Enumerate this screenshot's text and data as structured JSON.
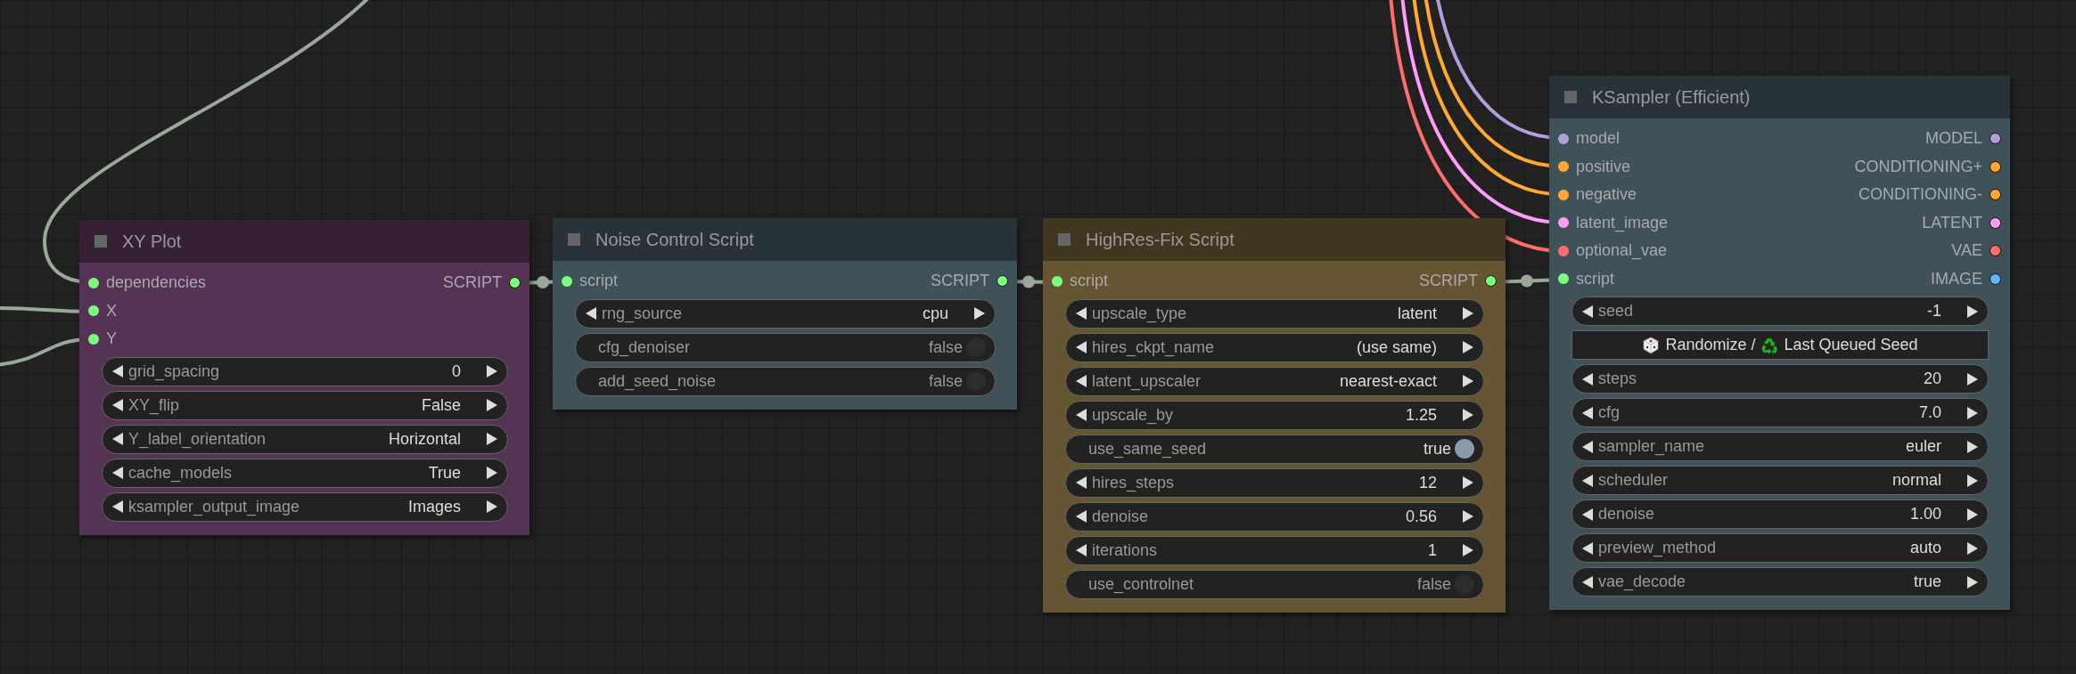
{
  "nodes": [
    {
      "title": "XY Plot",
      "color": "#553355",
      "inputs": [
        {
          "name": "dependencies",
          "color": "#7cfc7c"
        },
        {
          "name": "X",
          "color": "#7cfc7c"
        },
        {
          "name": "Y",
          "color": "#7cfc7c"
        }
      ],
      "outputs": [
        {
          "name": "SCRIPT",
          "color": "#7cfc7c"
        }
      ],
      "widgets": [
        {
          "kind": "combo",
          "label": "grid_spacing",
          "value": "0"
        },
        {
          "kind": "combo",
          "label": "XY_flip",
          "value": "False"
        },
        {
          "kind": "combo",
          "label": "Y_label_orientation",
          "value": "Horizontal"
        },
        {
          "kind": "combo",
          "label": "cache_models",
          "value": "True"
        },
        {
          "kind": "combo",
          "label": "ksampler_output_image",
          "value": "Images"
        }
      ]
    },
    {
      "title": "Noise Control Script",
      "color": "#3f5159",
      "inputs": [
        {
          "name": "script",
          "color": "#7cfc7c"
        }
      ],
      "outputs": [
        {
          "name": "SCRIPT",
          "color": "#7cfc7c"
        }
      ],
      "widgets": [
        {
          "kind": "combo",
          "label": "rng_source",
          "value": "cpu"
        },
        {
          "kind": "toggle",
          "label": "cfg_denoiser",
          "value": "false",
          "on": false
        },
        {
          "kind": "toggle",
          "label": "add_seed_noise",
          "value": "false",
          "on": false
        }
      ]
    },
    {
      "title": "HighRes-Fix Script",
      "color": "#665533",
      "inputs": [
        {
          "name": "script",
          "color": "#7cfc7c"
        }
      ],
      "outputs": [
        {
          "name": "SCRIPT",
          "color": "#7cfc7c"
        }
      ],
      "widgets": [
        {
          "kind": "combo",
          "label": "upscale_type",
          "value": "latent"
        },
        {
          "kind": "combo",
          "label": "hires_ckpt_name",
          "value": "(use same)"
        },
        {
          "kind": "combo",
          "label": "latent_upscaler",
          "value": "nearest-exact"
        },
        {
          "kind": "combo",
          "label": "upscale_by",
          "value": "1.25"
        },
        {
          "kind": "toggle",
          "label": "use_same_seed",
          "value": "true",
          "on": true
        },
        {
          "kind": "combo",
          "label": "hires_steps",
          "value": "12"
        },
        {
          "kind": "combo",
          "label": "denoise",
          "value": "0.56"
        },
        {
          "kind": "combo",
          "label": "iterations",
          "value": "1"
        },
        {
          "kind": "toggle",
          "label": "use_controlnet",
          "value": "false",
          "on": false
        }
      ]
    },
    {
      "title": "KSampler (Efficient)",
      "color": "#3f5159",
      "inputs": [
        {
          "name": "model",
          "color": "#b39ddb"
        },
        {
          "name": "positive",
          "color": "#ffa931"
        },
        {
          "name": "negative",
          "color": "#ffa931"
        },
        {
          "name": "latent_image",
          "color": "#ff9cf9"
        },
        {
          "name": "optional_vae",
          "color": "#ff6e6e"
        },
        {
          "name": "script",
          "color": "#7cfc7c"
        }
      ],
      "outputs": [
        {
          "name": "MODEL",
          "color": "#b39ddb"
        },
        {
          "name": "CONDITIONING+",
          "color": "#ffa931"
        },
        {
          "name": "CONDITIONING-",
          "color": "#ffa931"
        },
        {
          "name": "LATENT",
          "color": "#ff9cf9"
        },
        {
          "name": "VAE",
          "color": "#ff6e6e"
        },
        {
          "name": "IMAGE",
          "color": "#64b5f6"
        }
      ],
      "widgets": [
        {
          "kind": "combo",
          "label": "seed",
          "value": "-1"
        },
        {
          "kind": "button",
          "label": "Randomize /",
          "label_2": "Last Queued Seed"
        },
        {
          "kind": "combo",
          "label": "steps",
          "value": "20"
        },
        {
          "kind": "combo",
          "label": "cfg",
          "value": "7.0"
        },
        {
          "kind": "combo",
          "label": "sampler_name",
          "value": "euler"
        },
        {
          "kind": "combo",
          "label": "scheduler",
          "value": "normal"
        },
        {
          "kind": "combo",
          "label": "denoise",
          "value": "1.00"
        },
        {
          "kind": "combo",
          "label": "preview_method",
          "value": "auto"
        },
        {
          "kind": "combo",
          "label": "vae_decode",
          "value": "true"
        }
      ]
    }
  ]
}
